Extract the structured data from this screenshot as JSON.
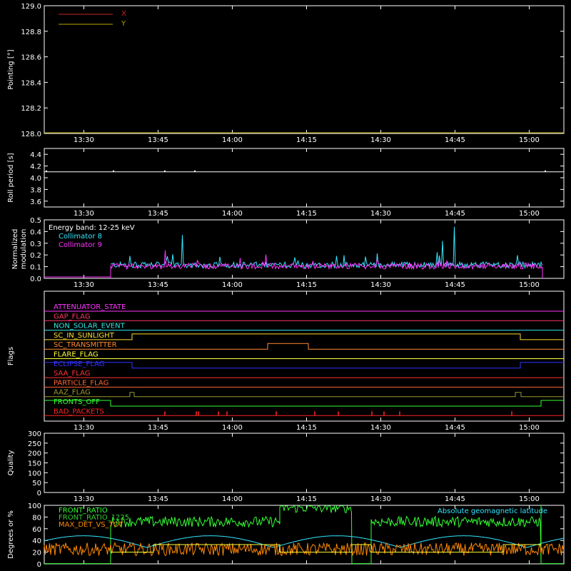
{
  "colors": {
    "background": "#000000",
    "axes": "#ffffff",
    "x": "#cc2222",
    "y": "#b3a600",
    "collimator8": "#33e6ff",
    "collimator9": "#ff33ff",
    "front_ratio": "#33ff33",
    "front_ratio_1225": "#33cc33",
    "max_det_vs_tot": "#ff8800",
    "latitude": "#33e6ff"
  },
  "chart_data": [
    {
      "type": "line",
      "id": "pointing",
      "ylabel": "Pointing [°]",
      "ylim": [
        128.0,
        129.0
      ],
      "yticks": [
        "128.0",
        "128.2",
        "128.4",
        "128.6",
        "128.8",
        "129.0"
      ],
      "xticks": [
        "13:30",
        "13:45",
        "14:00",
        "14:15",
        "14:30",
        "14:45",
        "15:00"
      ],
      "legend": [
        "X",
        "Y"
      ],
      "series": [
        {
          "name": "X",
          "values": []
        },
        {
          "name": "Y",
          "values": []
        }
      ]
    },
    {
      "type": "line",
      "id": "roll",
      "ylabel": "Roll period [s]",
      "ylim": [
        3.5,
        4.5
      ],
      "yticks": [
        "3.6",
        "3.8",
        "4.0",
        "4.2",
        "4.4"
      ],
      "xticks": [
        "13:30",
        "13:45",
        "14:00",
        "14:15",
        "14:30",
        "14:45",
        "15:00"
      ],
      "series": [
        {
          "values": [
            4.1,
            4.1
          ]
        }
      ]
    },
    {
      "type": "line",
      "id": "modulation",
      "ylabel": [
        "Normalized",
        "modulation"
      ],
      "ylim": [
        0.0,
        0.5
      ],
      "yticks": [
        "0.0",
        "0.1",
        "0.2",
        "0.3",
        "0.4",
        "0.5"
      ],
      "xticks": [
        "13:30",
        "13:45",
        "14:00",
        "14:15",
        "14:30",
        "14:45",
        "15:00"
      ],
      "legend_title": "Energy band: 12-25 keV",
      "series": [
        {
          "name": "Collimator 8",
          "values": []
        },
        {
          "name": "Collimator 9",
          "values": []
        }
      ]
    },
    {
      "type": "line",
      "id": "flags",
      "ylabel": "Flags",
      "xticks": [
        "13:30",
        "13:45",
        "14:00",
        "14:15",
        "14:30",
        "14:45",
        "15:00"
      ],
      "flags": [
        {
          "name": "ATTENUATOR_STATE",
          "color": "#ff33ff"
        },
        {
          "name": "GAP_FLAG",
          "color": "#ff3366"
        },
        {
          "name": "NON_SOLAR_EVENT",
          "color": "#33e6e6"
        },
        {
          "name": "SC_IN_SUNLIGHT",
          "color": "#ffdd33"
        },
        {
          "name": "SC_TRANSMITTER",
          "color": "#ff8833"
        },
        {
          "name": "FLARE_FLAG",
          "color": "#ffff33"
        },
        {
          "name": "ECLIPSE_FLAG",
          "color": "#3333ff"
        },
        {
          "name": "SAA_FLAG",
          "color": "#ff3333"
        },
        {
          "name": "PARTICLE_FLAG",
          "color": "#ff6633"
        },
        {
          "name": "AAZ_FLAG",
          "color": "#999933"
        },
        {
          "name": "FRONTS_OFF",
          "color": "#33ff33"
        },
        {
          "name": "BAD_PACKETS",
          "color": "#ff2222"
        }
      ]
    },
    {
      "type": "line",
      "id": "quality",
      "ylabel": "Quality",
      "ylim": [
        0,
        300
      ],
      "yticks": [
        "0",
        "50",
        "100",
        "150",
        "200",
        "250",
        "300"
      ],
      "xticks": [
        "13:30",
        "13:45",
        "14:00",
        "14:15",
        "14:30",
        "14:45",
        "15:00"
      ],
      "series": [
        {
          "values": []
        }
      ]
    },
    {
      "type": "line",
      "id": "ratios",
      "ylabel": "Degrees or %",
      "ylim": [
        0,
        100
      ],
      "yticks": [
        "0",
        "20",
        "40",
        "60",
        "80",
        "100"
      ],
      "legend": [
        "FRONT_RATIO",
        "FRONT_RATIO_1225",
        "MAX_DET_VS_TOT"
      ],
      "annotation": "Absolute geomagnetic latitude",
      "series": [
        {
          "name": "FRONT_RATIO",
          "values": []
        },
        {
          "name": "FRONT_RATIO_1225",
          "values": []
        },
        {
          "name": "MAX_DET_VS_TOT",
          "values": []
        },
        {
          "name": "Absolute geomagnetic latitude",
          "values": []
        }
      ]
    }
  ]
}
